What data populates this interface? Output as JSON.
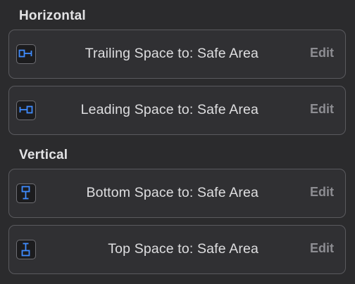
{
  "sections": {
    "horizontal": "Horizontal",
    "vertical": "Vertical"
  },
  "constraints": [
    {
      "label": "Trailing Space to:  Safe Area",
      "edit": "Edit",
      "icon": "trailing-space-icon"
    },
    {
      "label": "Leading Space to:  Safe Area",
      "edit": "Edit",
      "icon": "leading-space-icon"
    },
    {
      "label": "Bottom Space to:  Safe Area",
      "edit": "Edit",
      "icon": "bottom-space-icon"
    },
    {
      "label": "Top Space to:  Safe Area",
      "edit": "Edit",
      "icon": "top-space-icon"
    }
  ],
  "colors": {
    "background": "#2b2b2d",
    "accent_blue": "#3f8cff",
    "row_border": "#5a5a5e",
    "edit_text": "#8d8d92"
  }
}
